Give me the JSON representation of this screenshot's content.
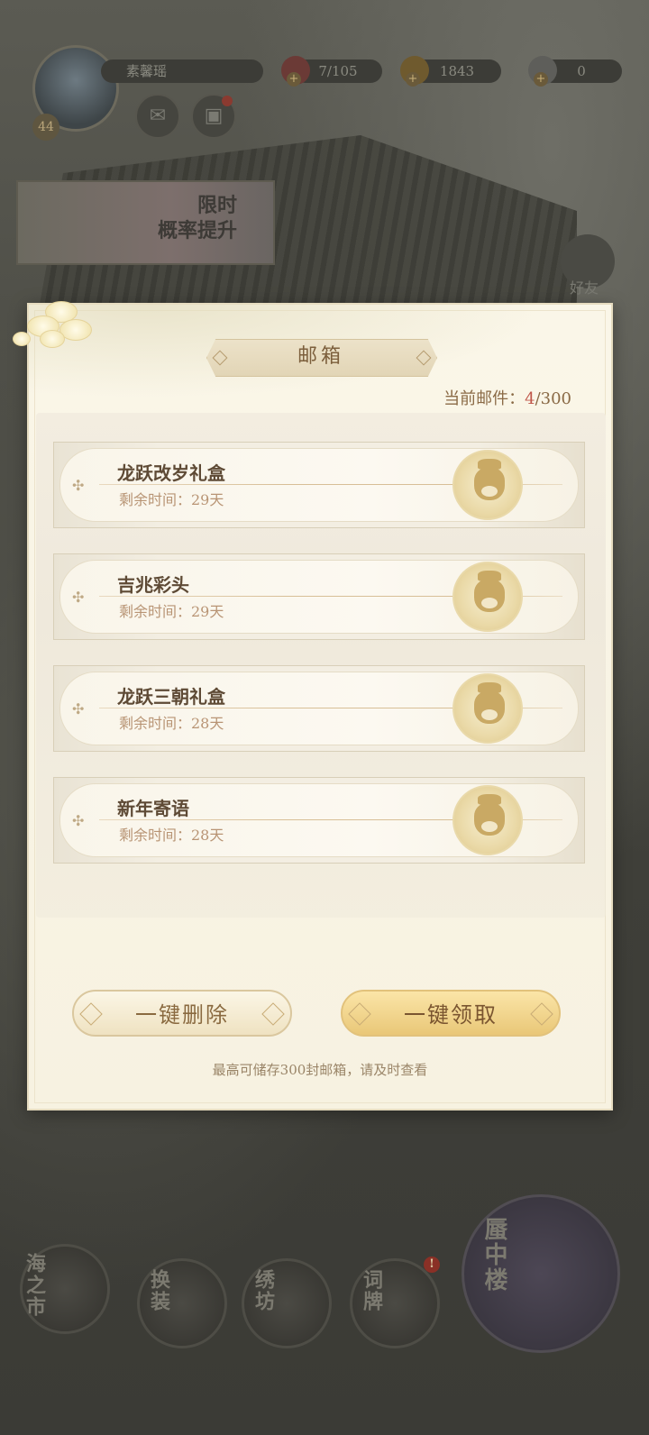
{
  "hud": {
    "level": "44",
    "player_name": "素馨瑶",
    "stamina": "7/105",
    "gold": "1843",
    "pearls": "0",
    "plus": "+"
  },
  "banner": {
    "text": "限时\n概率提升"
  },
  "friends_label": "好友",
  "mailbox": {
    "title": "邮箱",
    "count_label": "当前邮件：",
    "count_current": "4",
    "count_max": "/300",
    "items": [
      {
        "name": "龙跃改岁礼盒",
        "remaining": "剩余时间：29天"
      },
      {
        "name": "吉兆彩头",
        "remaining": "剩余时间：29天"
      },
      {
        "name": "龙跃三朝礼盒",
        "remaining": "剩余时间：28天"
      },
      {
        "name": "新年寄语",
        "remaining": "剩余时间：28天"
      }
    ],
    "delete_all": "一键删除",
    "claim_all": "一键领取",
    "note": "最高可储存300封邮箱，请及时查看"
  },
  "bottom_nav": {
    "sea_market": "海之市",
    "dress": "换装",
    "embroidery": "绣坊",
    "ci_pai": "词牌",
    "tower": "蜃中楼",
    "alert": "!"
  },
  "colors": {
    "accent_red": "#c0574a",
    "gold": "#e9c778"
  }
}
